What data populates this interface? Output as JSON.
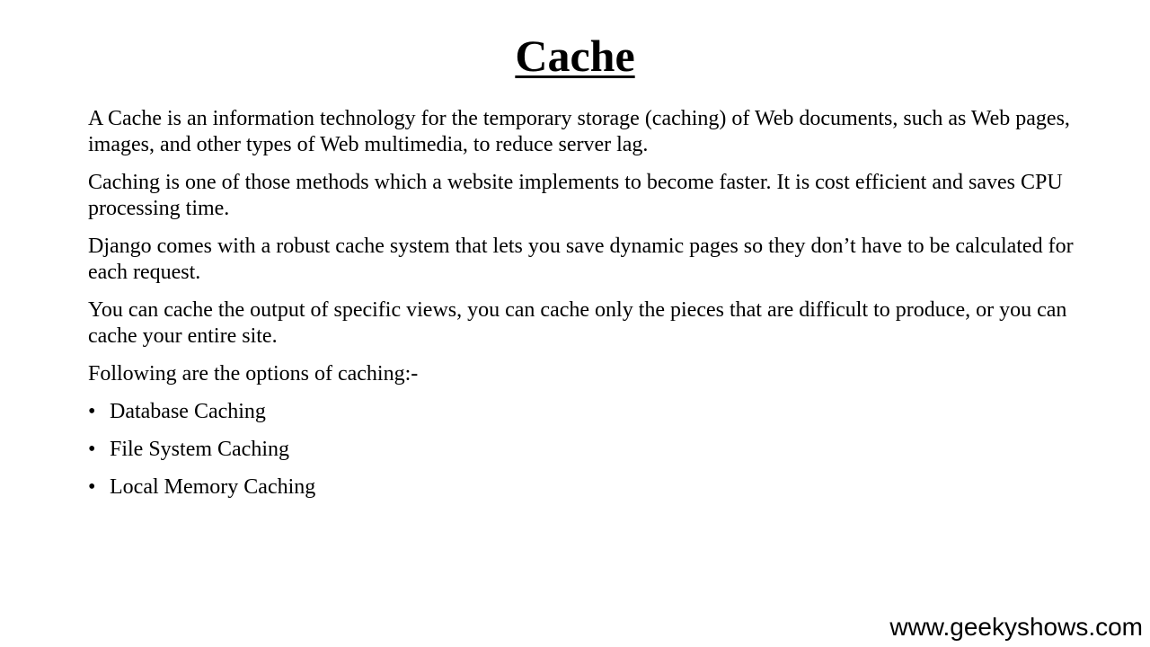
{
  "slide": {
    "title": "Cache",
    "paragraphs": [
      "A Cache is an information technology for the temporary storage (caching) of Web documents, such as Web pages, images, and other types of Web multimedia, to reduce server lag.",
      "Caching is one of those methods which a website implements to become faster. It is cost efficient and saves CPU processing time.",
      "Django comes with a robust cache system that lets you save dynamic pages so they don’t have to be calculated for each request.",
      "You can cache the output of specific views, you can cache only the pieces that are difficult to produce, or you can cache your entire site.",
      "Following are the options of caching:-"
    ],
    "bullet_symbol": "•",
    "bullets": [
      "Database Caching",
      "File System Caching",
      "Local Memory Caching"
    ],
    "footer": "www.geekyshows.com"
  }
}
